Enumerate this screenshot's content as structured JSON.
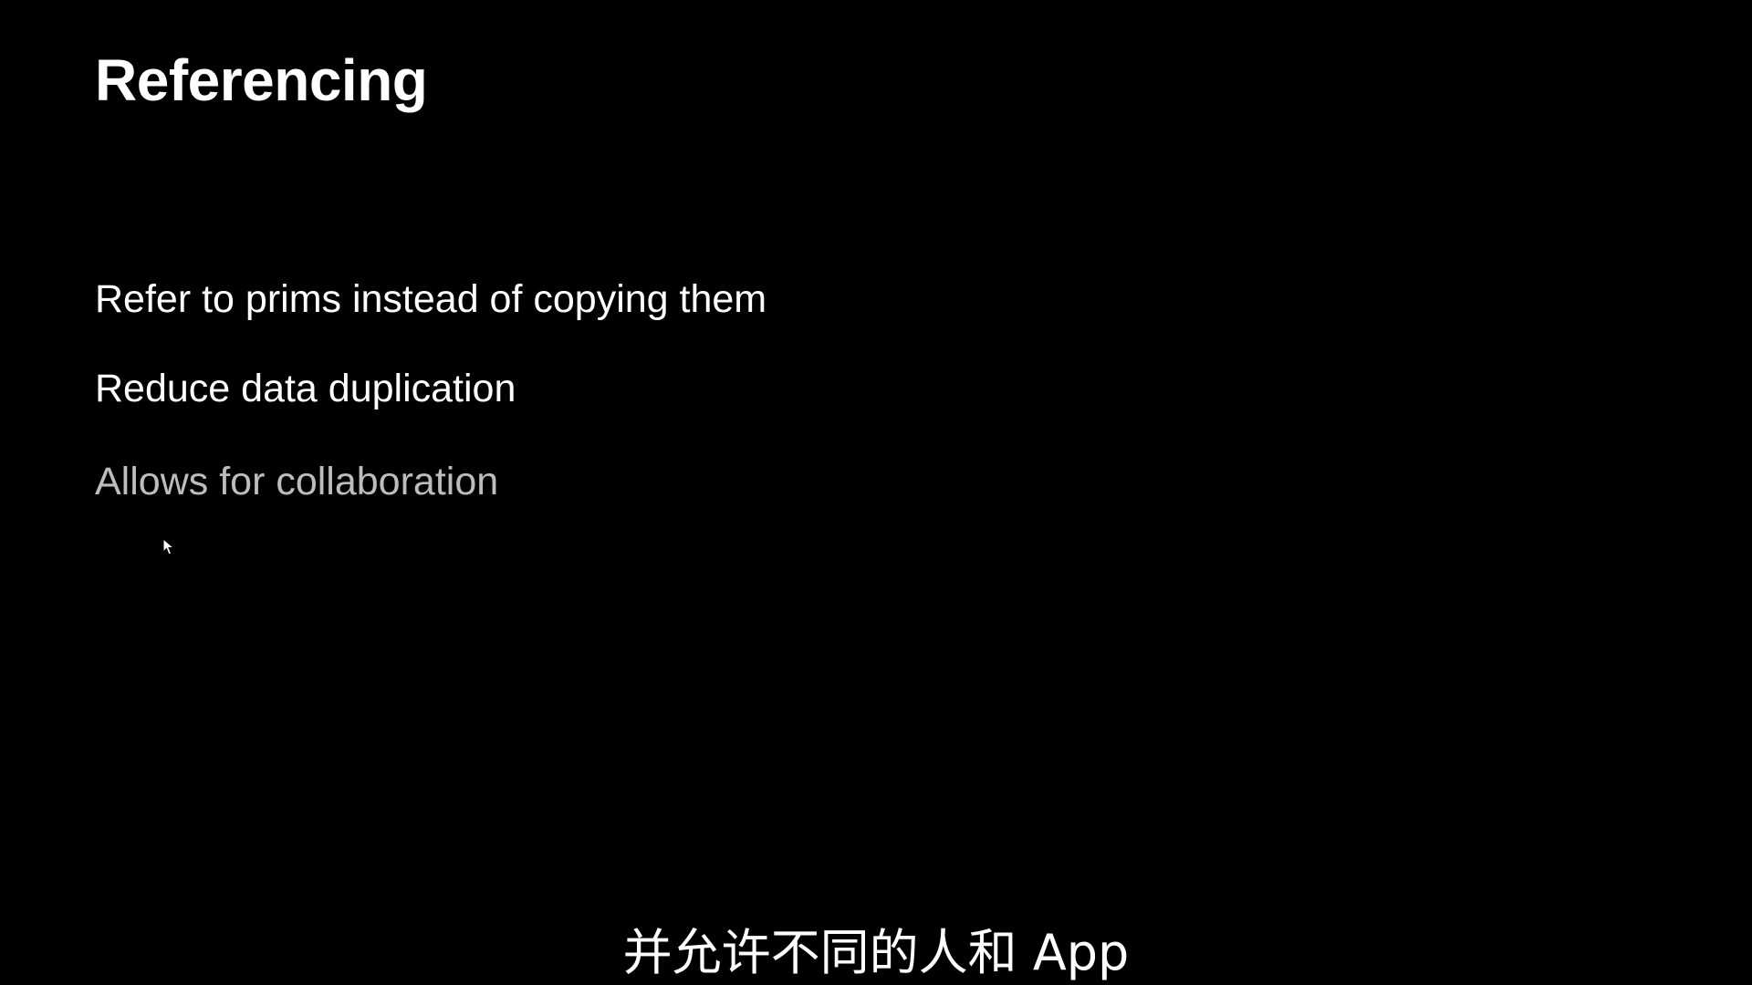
{
  "slide": {
    "title": "Referencing",
    "bullets": [
      "Refer to prims instead of copying them",
      "Reduce data duplication",
      "Allows for collaboration"
    ]
  },
  "caption": {
    "text": "并允许不同的人和 App"
  },
  "colors": {
    "background": "#000000",
    "text": "#ffffff",
    "dimmed_text": "#bdbdbd"
  },
  "icons": {
    "cursor": "mouse-pointer-icon"
  }
}
